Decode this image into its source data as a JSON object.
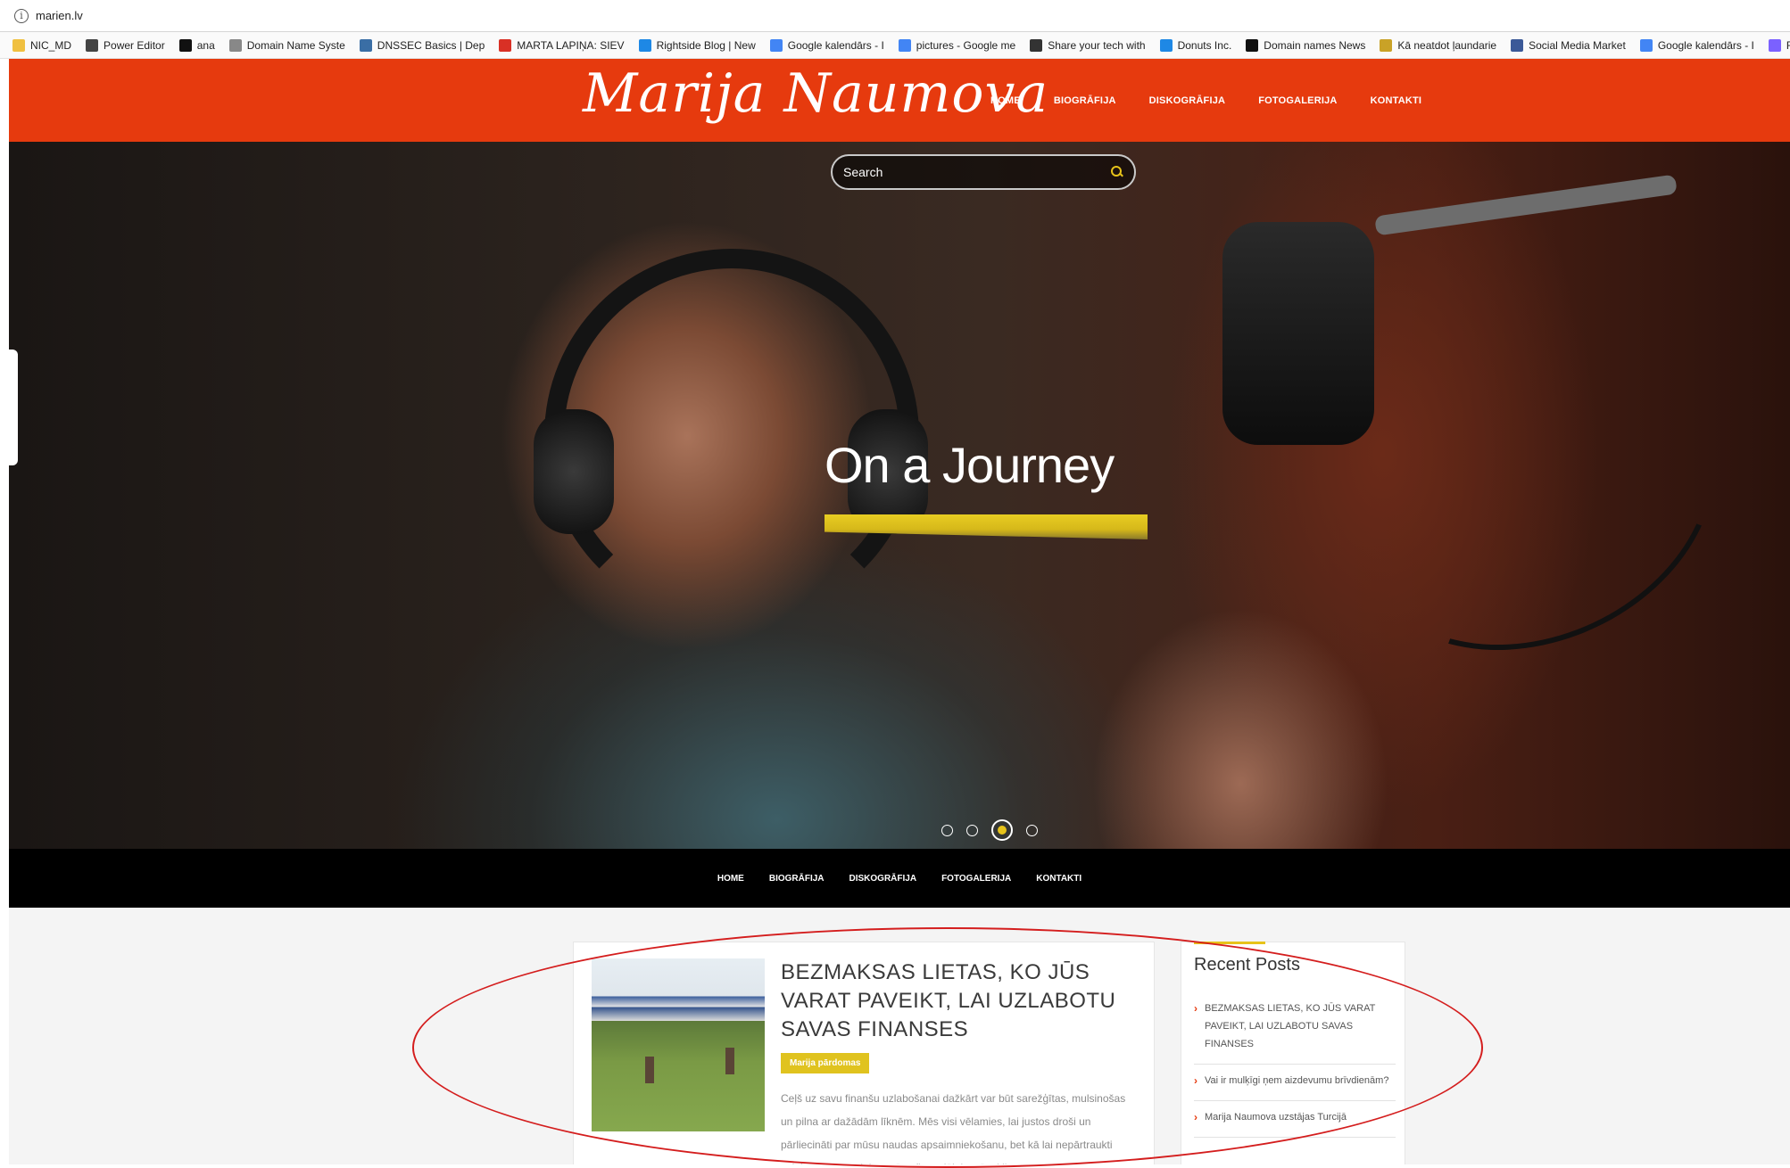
{
  "browser": {
    "url": "marien.lv",
    "bookmarks": [
      {
        "label": "NIC_MD",
        "icon": "folder-icon",
        "color": "#f0c040"
      },
      {
        "label": "Power Editor",
        "icon": "power-editor-icon",
        "color": "#444444"
      },
      {
        "label": "ana",
        "icon": "amazon-icon",
        "color": "#111111"
      },
      {
        "label": "Domain Name Syste",
        "icon": "page-icon",
        "color": "#888888"
      },
      {
        "label": "DNSSEC Basics | Dep",
        "icon": "dnssec-icon",
        "color": "#3a6ea5"
      },
      {
        "label": "MARTA LAPIŅA: SIEV",
        "icon": "gmail-icon",
        "color": "#d93025"
      },
      {
        "label": "Rightside Blog | New",
        "icon": "rightside-icon",
        "color": "#1e88e5"
      },
      {
        "label": "Google kalendārs - I",
        "icon": "calendar-icon",
        "color": "#4285f4"
      },
      {
        "label": "pictures - Google me",
        "icon": "google-icon",
        "color": "#4285f4"
      },
      {
        "label": "Share your tech with",
        "icon": "share-icon",
        "color": "#333333"
      },
      {
        "label": "Donuts Inc.",
        "icon": "donuts-icon",
        "color": "#1e88e5"
      },
      {
        "label": "Domain names News",
        "icon": "e-icon",
        "color": "#111111"
      },
      {
        "label": "Kā neatdot ļaundarie",
        "icon": "folder-icon",
        "color": "#c9a227"
      },
      {
        "label": "Social Media Market",
        "icon": "social-icon",
        "color": "#3b5998"
      },
      {
        "label": "Google kalendārs - I",
        "icon": "calendar-icon",
        "color": "#4285f4"
      },
      {
        "label": "Radix Extension Capt",
        "icon": "radix-icon",
        "color": "#7b61ff"
      }
    ]
  },
  "site": {
    "logo": "Marija Naumova",
    "nav": [
      "HOME",
      "BIOGRĀFIJA",
      "DISKOGRĀFIJA",
      "FOTOGALERIJA",
      "KONTAKTI"
    ],
    "search_placeholder": "Search",
    "slide": {
      "title": "On a Journey",
      "total": 4,
      "active_index": 2
    },
    "post": {
      "title": "BEZMAKSAS LIETAS, KO JŪS VARAT PAVEIKT, LAI UZLABOTU SAVAS FINANSES",
      "tag": "Marija pārdomas",
      "excerpt": "Ceļš uz savu finanšu uzlabošanai dažkārt var būt sarežģītas, mulsinošas un pilna ar dažādām līknēm. Mēs visi vēlamies, lai justos droši un pārliecināti par mūsu naudas apsaimniekošanu, bet kā lai nepārtraukti uzlabotu re-imagining mūsu finansiālais stāvoklis var"
    },
    "sidebar": {
      "title": "Recent Posts",
      "items": [
        "BEZMAKSAS LIETAS, KO JŪS VARAT PAVEIKT, LAI UZLABOTU SAVAS FINANSES",
        "Vai ir mulķīgi ņem aizdevumu brīvdienām?",
        "Marija Naumova uzstājas Turcijā"
      ]
    }
  },
  "colors": {
    "brand": "#e63a0e",
    "accent": "#e7c31a",
    "annotation": "#d41d1d"
  }
}
